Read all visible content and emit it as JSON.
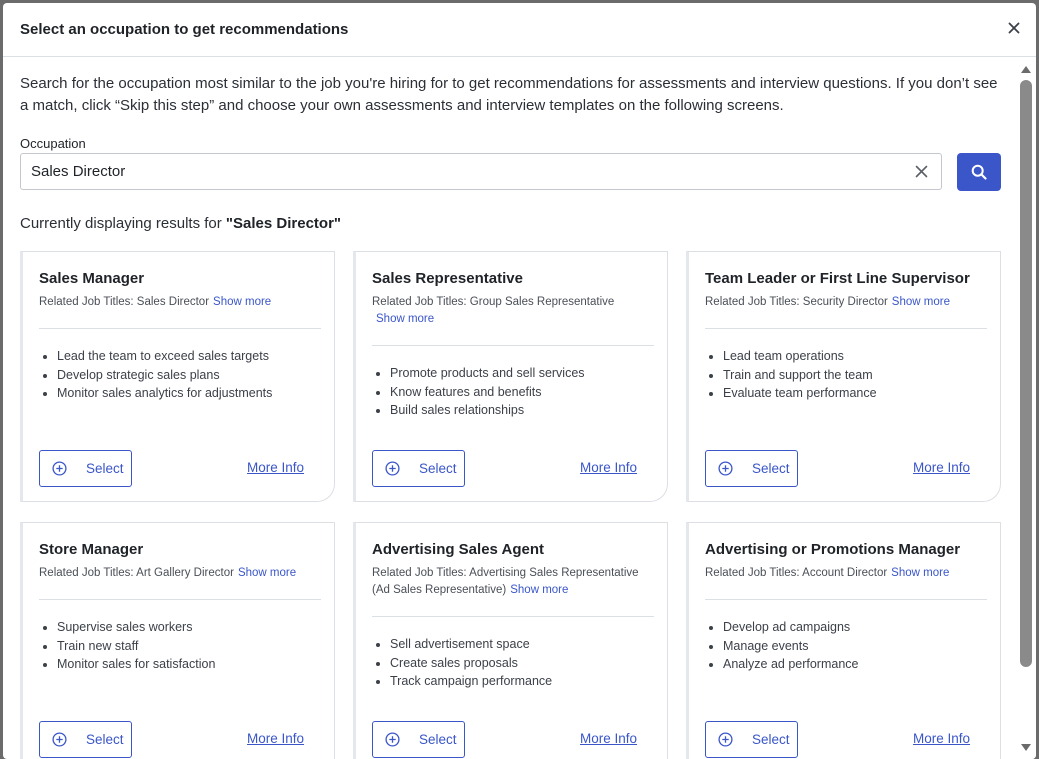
{
  "modal": {
    "title": "Select an occupation to get recommendations"
  },
  "intro": {
    "text": "Search for the occupation most similar to the job you're hiring for to get recommendations for assessments and interview questions. If you don’t see a match, click “Skip this step” and choose your own assessments and interview templates on the following screens."
  },
  "search": {
    "label": "Occupation",
    "value": "Sales Director"
  },
  "results": {
    "prefix": "Currently displaying results for ",
    "query": "\"Sales Director\""
  },
  "colors": {
    "accent": "#3a56c9",
    "border": "#dcdfe4",
    "text": "#1f2328"
  },
  "cards": [
    {
      "title": "Sales Manager",
      "related": "Related Job Titles: Sales Director",
      "show_more": "Show more",
      "bullets": [
        "Lead the team to exceed sales targets",
        "Develop strategic sales plans",
        "Monitor sales analytics for adjustments"
      ],
      "select_label": "Select",
      "more_info_label": "More Info"
    },
    {
      "title": "Sales Representative",
      "related": "Related Job Titles: Group Sales Representative",
      "show_more": "Show more",
      "bullets": [
        "Promote products and sell services",
        "Know features and benefits",
        "Build sales relationships"
      ],
      "select_label": "Select",
      "more_info_label": "More Info"
    },
    {
      "title": "Team Leader or First Line Supervisor",
      "related": "Related Job Titles: Security Director",
      "show_more": "Show more",
      "bullets": [
        "Lead team operations",
        "Train and support the team",
        "Evaluate team performance"
      ],
      "select_label": "Select",
      "more_info_label": "More Info"
    },
    {
      "title": "Store Manager",
      "related": "Related Job Titles: Art Gallery Director",
      "show_more": "Show more",
      "bullets": [
        "Supervise sales workers",
        "Train new staff",
        "Monitor sales for satisfaction"
      ],
      "select_label": "Select",
      "more_info_label": "More Info"
    },
    {
      "title": "Advertising Sales Agent",
      "related": "Related Job Titles: Advertising Sales Representative (Ad Sales Representative)",
      "show_more": "Show more",
      "bullets": [
        "Sell advertisement space",
        "Create sales proposals",
        "Track campaign performance"
      ],
      "select_label": "Select",
      "more_info_label": "More Info"
    },
    {
      "title": "Advertising or Promotions Manager",
      "related": "Related Job Titles: Account Director",
      "show_more": "Show more",
      "bullets": [
        "Develop ad campaigns",
        "Manage events",
        "Analyze ad performance"
      ],
      "select_label": "Select",
      "more_info_label": "More Info"
    }
  ]
}
